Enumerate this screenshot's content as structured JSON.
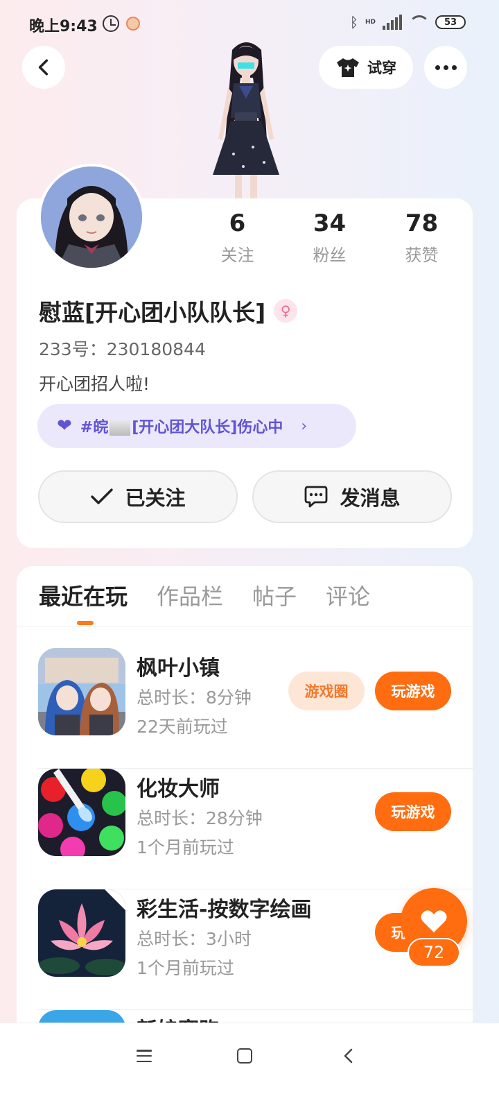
{
  "status_bar": {
    "time": "晚上9:43",
    "hd_label": "HD",
    "battery": "53"
  },
  "header": {
    "tryon_label": "试穿"
  },
  "profile": {
    "stats": [
      {
        "value": "6",
        "label": "关注"
      },
      {
        "value": "34",
        "label": "粉丝"
      },
      {
        "value": "78",
        "label": "获赞"
      }
    ],
    "nickname": "慰蓝[开心团小队队长]",
    "gender_symbol": "♀",
    "uid": "233号：230180844",
    "bio": "开心团招人啦!",
    "tag": {
      "text_prefix": "#皖",
      "text_suffix": "[开心团大队长]伤心中",
      "chevron": "›"
    },
    "follow_button": "已关注",
    "message_button": "发消息"
  },
  "tabs": [
    "最近在玩",
    "作品栏",
    "帖子",
    "评论"
  ],
  "active_tab": 0,
  "games": [
    {
      "name": "枫叶小镇",
      "duration": "总时长：8分钟",
      "last_played": "22天前玩过",
      "circle_label": "游戏圈",
      "play_label": "玩游戏"
    },
    {
      "name": "化妆大师",
      "duration": "总时长：28分钟",
      "last_played": "1个月前玩过",
      "play_label": "玩游戏"
    },
    {
      "name": "彩生活-按数字绘画",
      "duration": "总时长：3小时",
      "last_played": "1个月前玩过",
      "play_label": "玩游戏"
    },
    {
      "name": "新娘赛跑"
    }
  ],
  "like": {
    "count": "72"
  },
  "colors": {
    "accent": "#ff6d10",
    "tag_text": "#5f54d4",
    "tag_bg": "#ece8fc"
  }
}
